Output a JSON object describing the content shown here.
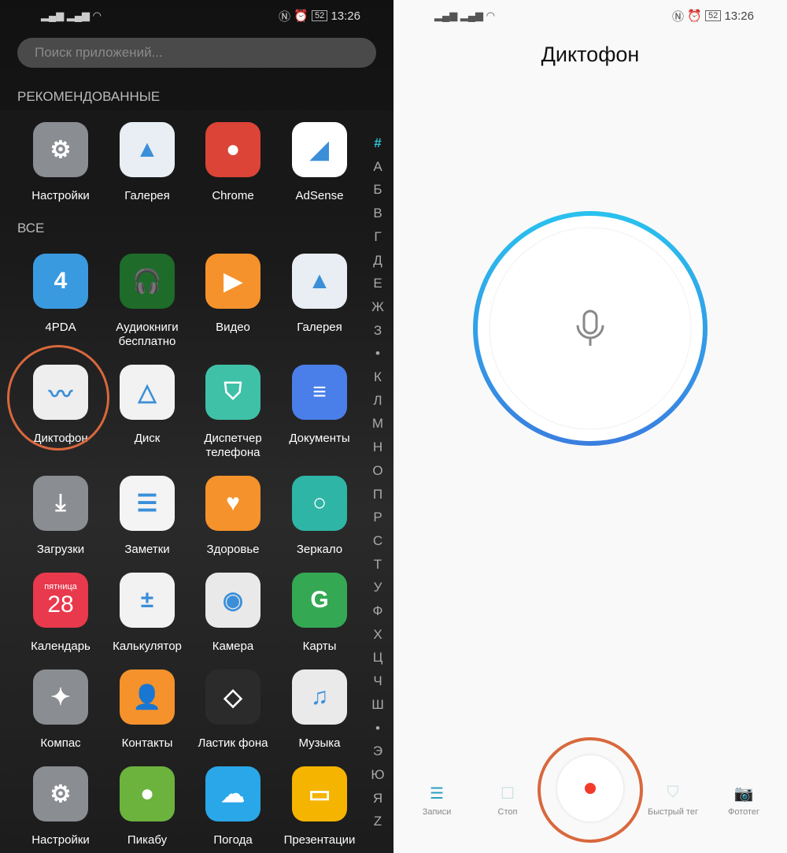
{
  "status": {
    "time": "13:26",
    "battery": "52"
  },
  "drawer": {
    "search_placeholder": "Поиск приложений...",
    "recommended_title": "РЕКОМЕНДОВАННЫЕ",
    "all_title": "ВСЕ",
    "recommended": [
      {
        "label": "Настройки",
        "icon": "settings-icon",
        "color": "#8a8d92",
        "glyph": "⚙"
      },
      {
        "label": "Галерея",
        "icon": "gallery-icon",
        "color": "#e8eef3",
        "glyph": "▲"
      },
      {
        "label": "Chrome",
        "icon": "chrome-icon",
        "color": "#db4437",
        "glyph": "●"
      },
      {
        "label": "AdSense",
        "icon": "adsense-icon",
        "color": "#ffffff",
        "glyph": "◢"
      }
    ],
    "apps": [
      {
        "label": "4PDA",
        "icon": "4pda-icon",
        "color": "#3a9ae0",
        "glyph": "4"
      },
      {
        "label": "Аудиокниги бесплатно",
        "icon": "audiobooks-icon",
        "color": "#1e6b2a",
        "glyph": "🎧"
      },
      {
        "label": "Видео",
        "icon": "video-icon",
        "color": "#f5922c",
        "glyph": "▶"
      },
      {
        "label": "Галерея",
        "icon": "gallery-icon",
        "color": "#e8eef3",
        "glyph": "▲"
      },
      {
        "label": "Диктофон",
        "icon": "recorder-icon",
        "color": "#eeeeee",
        "glyph": "〰"
      },
      {
        "label": "Диск",
        "icon": "drive-icon",
        "color": "#f2f2f2",
        "glyph": "△"
      },
      {
        "label": "Диспетчер телефона",
        "icon": "phone-manager-icon",
        "color": "#3fc1a8",
        "glyph": "⛉"
      },
      {
        "label": "Документы",
        "icon": "documents-icon",
        "color": "#4a7ee8",
        "glyph": "≡"
      },
      {
        "label": "Загрузки",
        "icon": "downloads-icon",
        "color": "#8a8d92",
        "glyph": "⤓"
      },
      {
        "label": "Заметки",
        "icon": "notes-icon",
        "color": "#f4f4f4",
        "glyph": "☰"
      },
      {
        "label": "Здоровье",
        "icon": "health-icon",
        "color": "#f5922c",
        "glyph": "♥"
      },
      {
        "label": "Зеркало",
        "icon": "mirror-icon",
        "color": "#2fb5a5",
        "glyph": "○"
      },
      {
        "label": "Календарь",
        "icon": "calendar-icon",
        "color": "#e8394d",
        "glyph": "28",
        "sub": "пятница"
      },
      {
        "label": "Калькулятор",
        "icon": "calculator-icon",
        "color": "#f2f2f2",
        "glyph": "±"
      },
      {
        "label": "Камера",
        "icon": "camera-icon",
        "color": "#e9e9e9",
        "glyph": "◉"
      },
      {
        "label": "Карты",
        "icon": "maps-icon",
        "color": "#34a853",
        "glyph": "G"
      },
      {
        "label": "Компас",
        "icon": "compass-icon",
        "color": "#8a8d92",
        "glyph": "✦"
      },
      {
        "label": "Контакты",
        "icon": "contacts-icon",
        "color": "#f5922c",
        "glyph": "👤"
      },
      {
        "label": "Ластик фона",
        "icon": "eraser-icon",
        "color": "#2b2b2b",
        "glyph": "◇"
      },
      {
        "label": "Музыка",
        "icon": "music-icon",
        "color": "#eaeaea",
        "glyph": "♫"
      },
      {
        "label": "Настройки",
        "icon": "settings-icon",
        "color": "#8a8d92",
        "glyph": "⚙"
      },
      {
        "label": "Пикабу",
        "icon": "pikabu-icon",
        "color": "#6cb33e",
        "glyph": "●"
      },
      {
        "label": "Погода",
        "icon": "weather-icon",
        "color": "#2aa7e8",
        "glyph": "☁"
      },
      {
        "label": "Презентации",
        "icon": "presentations-icon",
        "color": "#f5b400",
        "glyph": "▭"
      }
    ],
    "alphabet": [
      "#",
      "А",
      "Б",
      "В",
      "Г",
      "Д",
      "Е",
      "Ж",
      "З",
      "•",
      "К",
      "Л",
      "М",
      "Н",
      "О",
      "П",
      "Р",
      "С",
      "Т",
      "У",
      "Ф",
      "Х",
      "Ц",
      "Ч",
      "Ш",
      "•",
      "Э",
      "Ю",
      "Я",
      "Z"
    ],
    "accent": "#2fc1d6"
  },
  "recorder": {
    "title": "Диктофон",
    "nav": [
      {
        "label": "Записи",
        "icon": "list-icon"
      },
      {
        "label": "Стоп",
        "icon": "stop-icon"
      },
      {
        "label": "Быстрый тег",
        "icon": "bookmark-icon"
      },
      {
        "label": "Фототег",
        "icon": "camera-icon"
      }
    ],
    "record_color": "#f33a2a",
    "annotation_color": "#d9683d"
  }
}
